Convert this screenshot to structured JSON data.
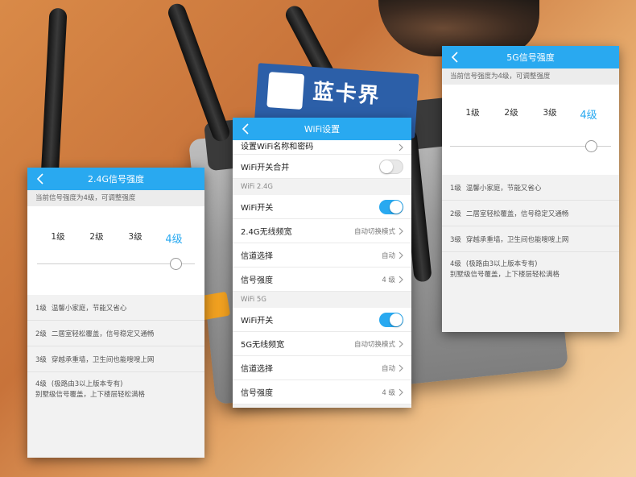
{
  "background": {
    "sign_text": "蓝卡界"
  },
  "left_panel": {
    "title": "2.4G信号强度",
    "hint": "当前信号强度为4级，可调整强度",
    "levels": [
      "1级",
      "2级",
      "3级",
      "4级"
    ],
    "selected_level": "4级",
    "slider_value_fraction": 1.0,
    "descriptions": [
      {
        "level": "1级",
        "text": "温馨小家庭，节能又省心"
      },
      {
        "level": "2级",
        "text": "二居室轻松覆盖，信号稳定又通畅"
      },
      {
        "level": "3级",
        "text": "穿越承重墙，卫生间也能嗖嗖上网"
      },
      {
        "level": "4级",
        "text": "(极路由3以上版本专有)",
        "text2": "别墅级信号覆盖，上下楼层轻松满格"
      }
    ]
  },
  "middle_panel": {
    "title": "WiFi设置",
    "rows_top": [
      {
        "label": "设置WiFi名称和密码",
        "value": ""
      },
      {
        "label": "WiFi开关合并",
        "toggle": "off"
      }
    ],
    "section_24": "WiFi 2.4G",
    "rows_24": [
      {
        "label": "WiFi开关",
        "toggle": "on"
      },
      {
        "label": "2.4G无线频宽",
        "value": "自动切换模式"
      },
      {
        "label": "信道选择",
        "value": "自动"
      },
      {
        "label": "信号强度",
        "value": "4 级"
      }
    ],
    "section_5": "WiFi 5G",
    "rows_5": [
      {
        "label": "WiFi开关",
        "toggle": "on"
      },
      {
        "label": "5G无线频宽",
        "value": "自动切换模式"
      },
      {
        "label": "信道选择",
        "value": "自动"
      },
      {
        "label": "信号强度",
        "value": "4 级"
      }
    ]
  },
  "right_panel": {
    "title": "5G信号强度",
    "hint": "当前信号强度为4级，可调整强度",
    "levels": [
      "1级",
      "2级",
      "3级",
      "4级"
    ],
    "selected_level": "4级",
    "slider_value_fraction": 1.0,
    "descriptions": [
      {
        "level": "1级",
        "text": "温馨小家庭，节能又省心"
      },
      {
        "level": "2级",
        "text": "二居室轻松覆盖，信号稳定又通畅"
      },
      {
        "level": "3级",
        "text": "穿越承重墙，卫生间也能嗖嗖上网"
      },
      {
        "level": "4级",
        "text": "(极路由3以上版本专有)",
        "text2": "别墅级信号覆盖，上下楼层轻松满格"
      }
    ]
  },
  "colors": {
    "accent": "#29a9f0",
    "panel_bg": "#f2f2f2"
  }
}
